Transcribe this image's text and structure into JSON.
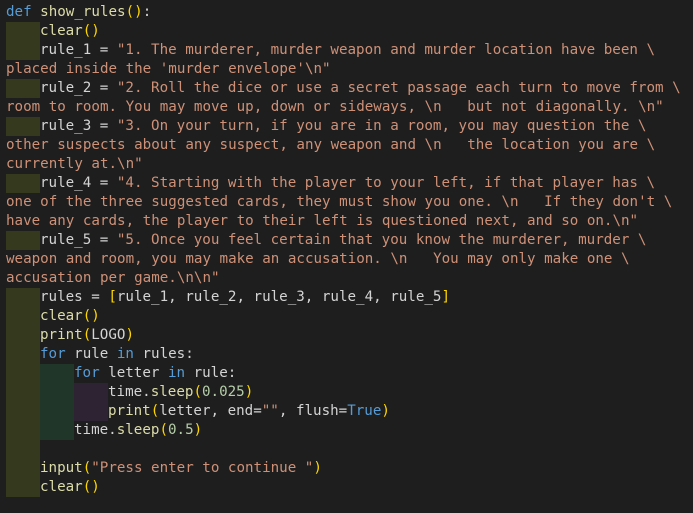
{
  "code": {
    "l1_kw": "def",
    "l1_fn": "show_rules",
    "l1_br": "()",
    "l1_rest": ":",
    "l2_fn": "clear",
    "l2_br": "()",
    "l3_var": "rule_1 = ",
    "l3_str": "\"1. The murderer, murder weapon and murder location have been \\",
    "l4_str": "placed inside the 'murder envelope'\\n\"",
    "l5_var": "rule_2 = ",
    "l5_str": "\"2. Roll the dice or use a secret passage each turn to move from \\",
    "l6_str": "room to room. You may move up, down or sideways, \\n   but not diagonally. \\n\"",
    "l7_var": "rule_3 = ",
    "l7_str": "\"3. On your turn, if you are in a room, you may question the \\",
    "l8_str": "other suspects about any suspect, any weapon and \\n   the location you are \\",
    "l9_str": "currently at.\\n\"",
    "l10_var": "rule_4 = ",
    "l10_str": "\"4. Starting with the player to your left, if that player has \\",
    "l11_str": "one of the three suggested cards, they must show you one. \\n   If they don't \\",
    "l12_str": "have any cards, the player to their left is questioned next, and so on.\\n\"",
    "l13_var": "rule_5 = ",
    "l13_str": "\"5. Once you feel certain that you know the murderer, murder \\",
    "l14_str": "weapon and room, you may make an accusation. \\n   You may only make one \\",
    "l15_str": "accusation per game.\\n\\n\"",
    "l16_a": "rules = ",
    "l16_ob": "[",
    "l16_b": "rule_1, rule_2, rule_3, rule_4, rule_5",
    "l16_cb": "]",
    "l17_fn": "clear",
    "l17_br": "()",
    "l18_fn": "print",
    "l18_ob": "(",
    "l18_arg": "LOGO",
    "l18_cb": ")",
    "l19_kw1": "for",
    "l19_a": " rule ",
    "l19_kw2": "in",
    "l19_b": " rules:",
    "l20_kw1": "for",
    "l20_a": " letter ",
    "l20_kw2": "in",
    "l20_b": " rule:",
    "l21_a": "time.",
    "l21_fn": "sleep",
    "l21_ob": "(",
    "l21_num": "0.025",
    "l21_cb": ")",
    "l22_fn": "print",
    "l22_ob": "(",
    "l22_a": "letter, end=",
    "l22_str": "\"\"",
    "l22_b": ", flush=",
    "l22_kw": "True",
    "l22_cb": ")",
    "l23_a": "time.",
    "l23_fn": "sleep",
    "l23_ob": "(",
    "l23_num": "0.5",
    "l23_cb": ")",
    "l25_fn": "input",
    "l25_ob": "(",
    "l25_str": "\"Press enter to continue \"",
    "l25_cb": ")",
    "l26_fn": "clear",
    "l26_br": "()"
  }
}
